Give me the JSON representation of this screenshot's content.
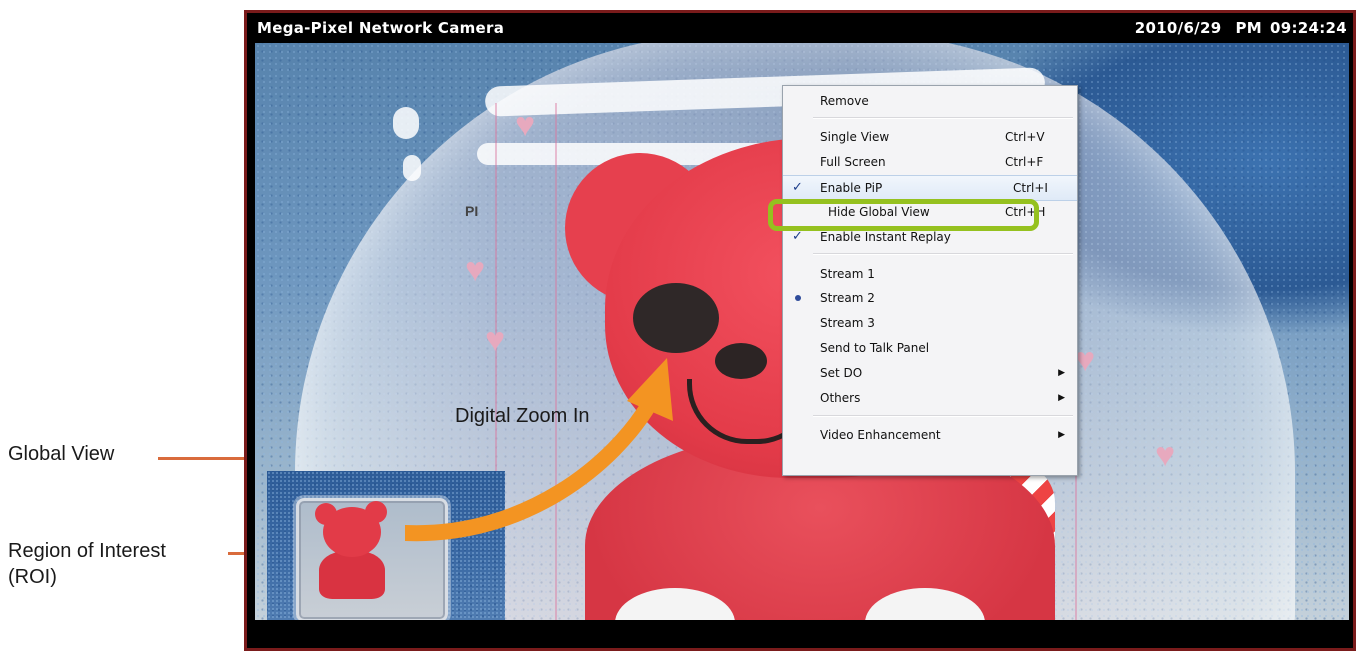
{
  "camera": {
    "title": "Mega-Pixel Network Camera",
    "date": "2010/6/29",
    "ampm": "PM",
    "time": "09:24:24"
  },
  "video": {
    "overlay_text": "PI"
  },
  "context_menu": {
    "items": {
      "remove": {
        "label": "Remove"
      },
      "single_view": {
        "label": "Single View",
        "shortcut": "Ctrl+V"
      },
      "full_screen": {
        "label": "Full Screen",
        "shortcut": "Ctrl+F"
      },
      "enable_pip": {
        "label": "Enable PiP",
        "shortcut": "Ctrl+I",
        "checked": true
      },
      "hide_global_view": {
        "label": "Hide Global View",
        "shortcut": "Ctrl+H"
      },
      "enable_instant_replay": {
        "label": "Enable Instant Replay",
        "checked": true
      },
      "stream1": {
        "label": "Stream 1"
      },
      "stream2": {
        "label": "Stream 2",
        "selected": true
      },
      "stream3": {
        "label": "Stream 3"
      },
      "send_to_talk_panel": {
        "label": "Send to Talk Panel"
      },
      "set_do": {
        "label": "Set DO",
        "submenu": true
      },
      "others": {
        "label": "Others",
        "submenu": true
      },
      "video_enhancement": {
        "label": "Video Enhancement",
        "submenu": true
      }
    }
  },
  "annotations": {
    "digital_zoom": "Digital Zoom In",
    "global_view": "Global View",
    "roi_line1": "Region of Interest",
    "roi_line2": "(ROI)"
  },
  "colors": {
    "frame_border": "#7a1b1b",
    "highlight": "#95c11f",
    "arrow": "#f39422",
    "leader_line": "#d96b3c"
  }
}
